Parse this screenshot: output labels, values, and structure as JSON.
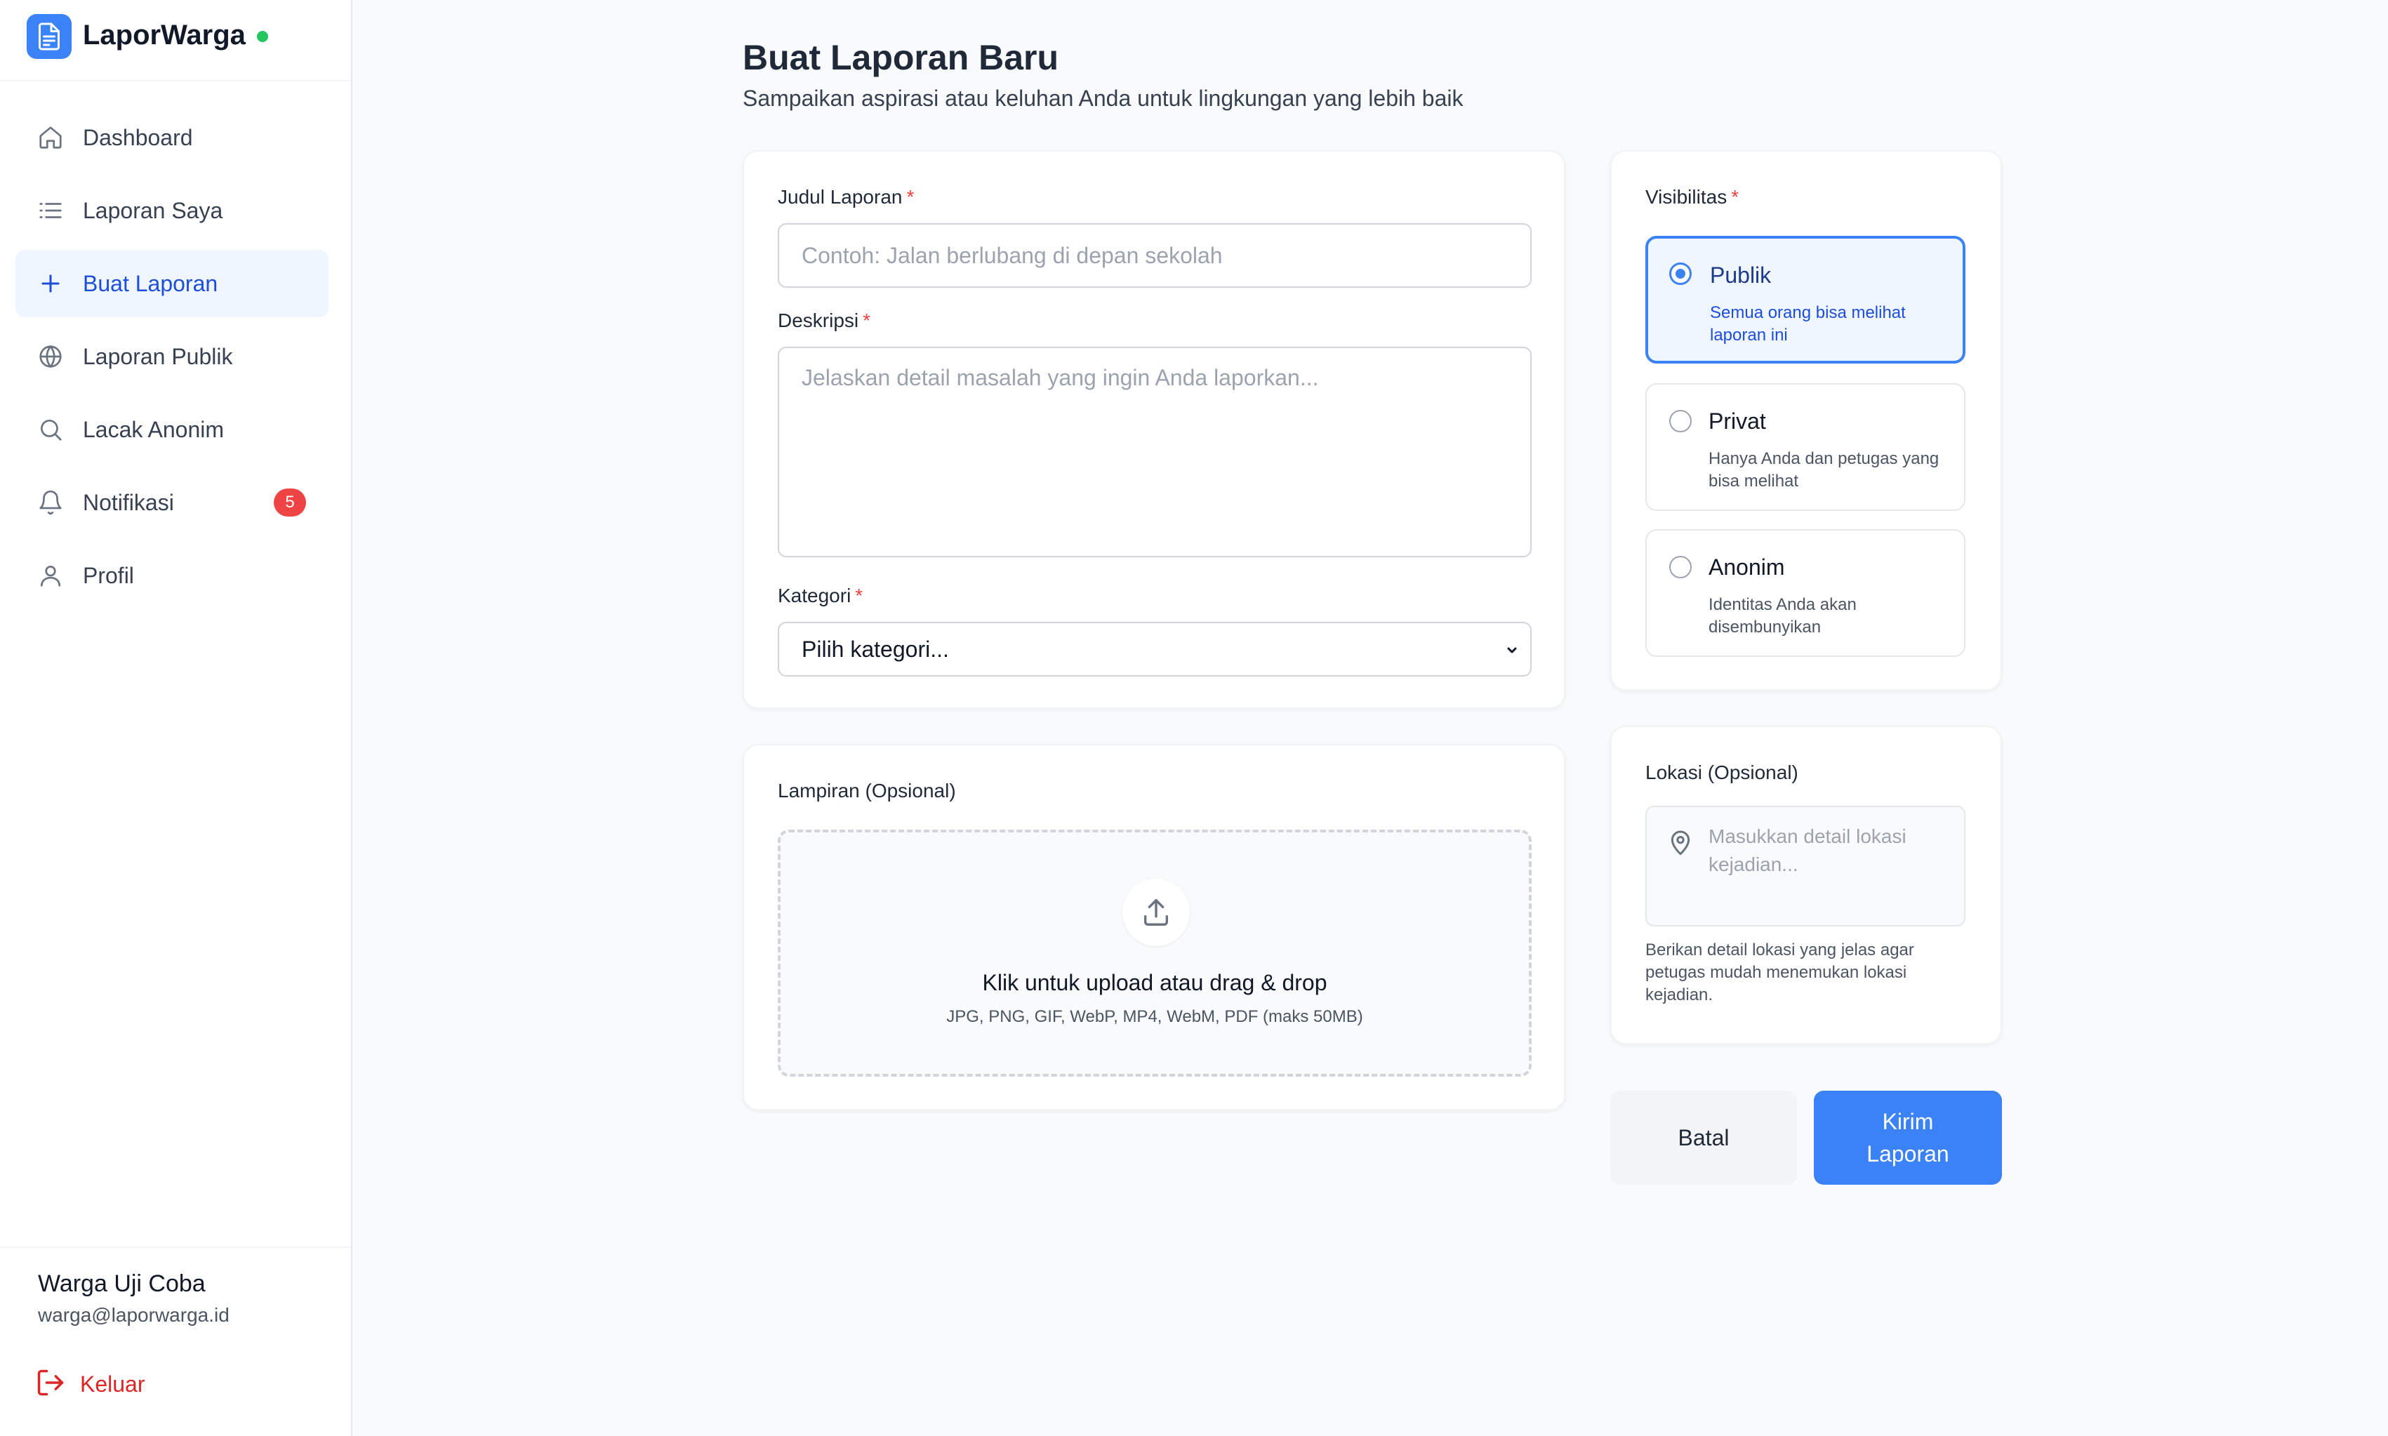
{
  "app": {
    "name": "LaporWarga",
    "status_icon": "online-dot-icon",
    "colors": {
      "accent": "#3b82f6",
      "status": "#22c55e",
      "badge": "#ef4444",
      "danger": "#dc2626"
    }
  },
  "sidebar": {
    "items": [
      {
        "label": "Dashboard",
        "icon": "home-icon",
        "active": false
      },
      {
        "label": "Laporan Saya",
        "icon": "list-icon",
        "active": false
      },
      {
        "label": "Buat Laporan",
        "icon": "plus-icon",
        "active": true
      },
      {
        "label": "Laporan Publik",
        "icon": "globe-icon",
        "active": false
      },
      {
        "label": "Lacak Anonim",
        "icon": "search-icon",
        "active": false
      },
      {
        "label": "Notifikasi",
        "icon": "bell-icon",
        "active": false,
        "badge": "5"
      },
      {
        "label": "Profil",
        "icon": "user-icon",
        "active": false
      }
    ],
    "user": {
      "name": "Warga Uji Coba",
      "email": "warga@laporwarga.id",
      "logout_label": "Keluar"
    }
  },
  "page": {
    "title": "Buat Laporan Baru",
    "subtitle": "Sampaikan aspirasi atau keluhan Anda untuk lingkungan yang lebih baik"
  },
  "form": {
    "required_mark": "*",
    "title_field": {
      "label": "Judul Laporan",
      "placeholder": "Contoh: Jalan berlubang di depan sekolah"
    },
    "description_field": {
      "label": "Deskripsi",
      "placeholder": "Jelaskan detail masalah yang ingin Anda laporkan..."
    },
    "category_field": {
      "label": "Kategori",
      "value": "Pilih kategori..."
    },
    "attachment": {
      "label": "Lampiran (Opsional)",
      "upload_title": "Klik untuk upload atau drag & drop",
      "upload_hint": "JPG, PNG, GIF, WebP, MP4, WebM, PDF (maks 50MB)"
    },
    "visibility": {
      "label": "Visibilitas",
      "options": [
        {
          "title": "Publik",
          "description": "Semua orang bisa melihat laporan ini",
          "selected": true
        },
        {
          "title": "Privat",
          "description": "Hanya Anda dan petugas yang bisa melihat",
          "selected": false
        },
        {
          "title": "Anonim",
          "description": "Identitas Anda akan disembunyikan",
          "selected": false
        }
      ]
    },
    "location": {
      "label": "Lokasi (Opsional)",
      "placeholder": "Masukkan detail lokasi kejadian...",
      "hint": "Berikan detail lokasi yang jelas agar petugas mudah menemukan lokasi kejadian."
    },
    "actions": {
      "cancel_label": "Batal",
      "submit_label": "Kirim Laporan"
    }
  }
}
